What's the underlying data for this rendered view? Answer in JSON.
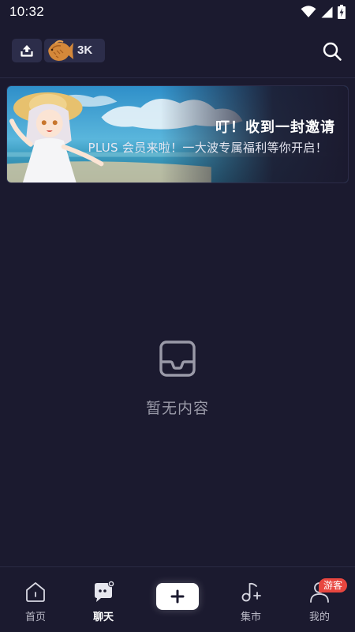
{
  "status_bar": {
    "time": "10:32",
    "icons": [
      "wifi-icon",
      "signal-icon",
      "battery-charging-icon"
    ]
  },
  "top_bar": {
    "upload_icon": "upload-icon",
    "coin_icon": "taiyaki-fish-icon",
    "coin_count": "3K",
    "search_icon": "search-icon"
  },
  "banner": {
    "title": "叮！收到一封邀请",
    "subtitle": "PLUS 会员来啦！一大波专属福利等你开启！"
  },
  "empty_state": {
    "icon": "inbox-tray-icon",
    "text": "暂无内容"
  },
  "bottom_nav": {
    "items": [
      {
        "label": "首页",
        "icon": "home-icon",
        "active": false
      },
      {
        "label": "聊天",
        "icon": "chat-bubble-icon",
        "active": true
      },
      {
        "label": "",
        "icon": "plus-icon",
        "active": false
      },
      {
        "label": "集市",
        "icon": "music-note-icon",
        "active": false
      },
      {
        "label": "我的",
        "icon": "person-icon",
        "active": false
      }
    ],
    "guest_badge": "游客"
  },
  "colors": {
    "background": "#1b1a2f",
    "pill": "#2c2d4a",
    "badge": "#e8463f",
    "muted_text": "#9a9aa8"
  }
}
